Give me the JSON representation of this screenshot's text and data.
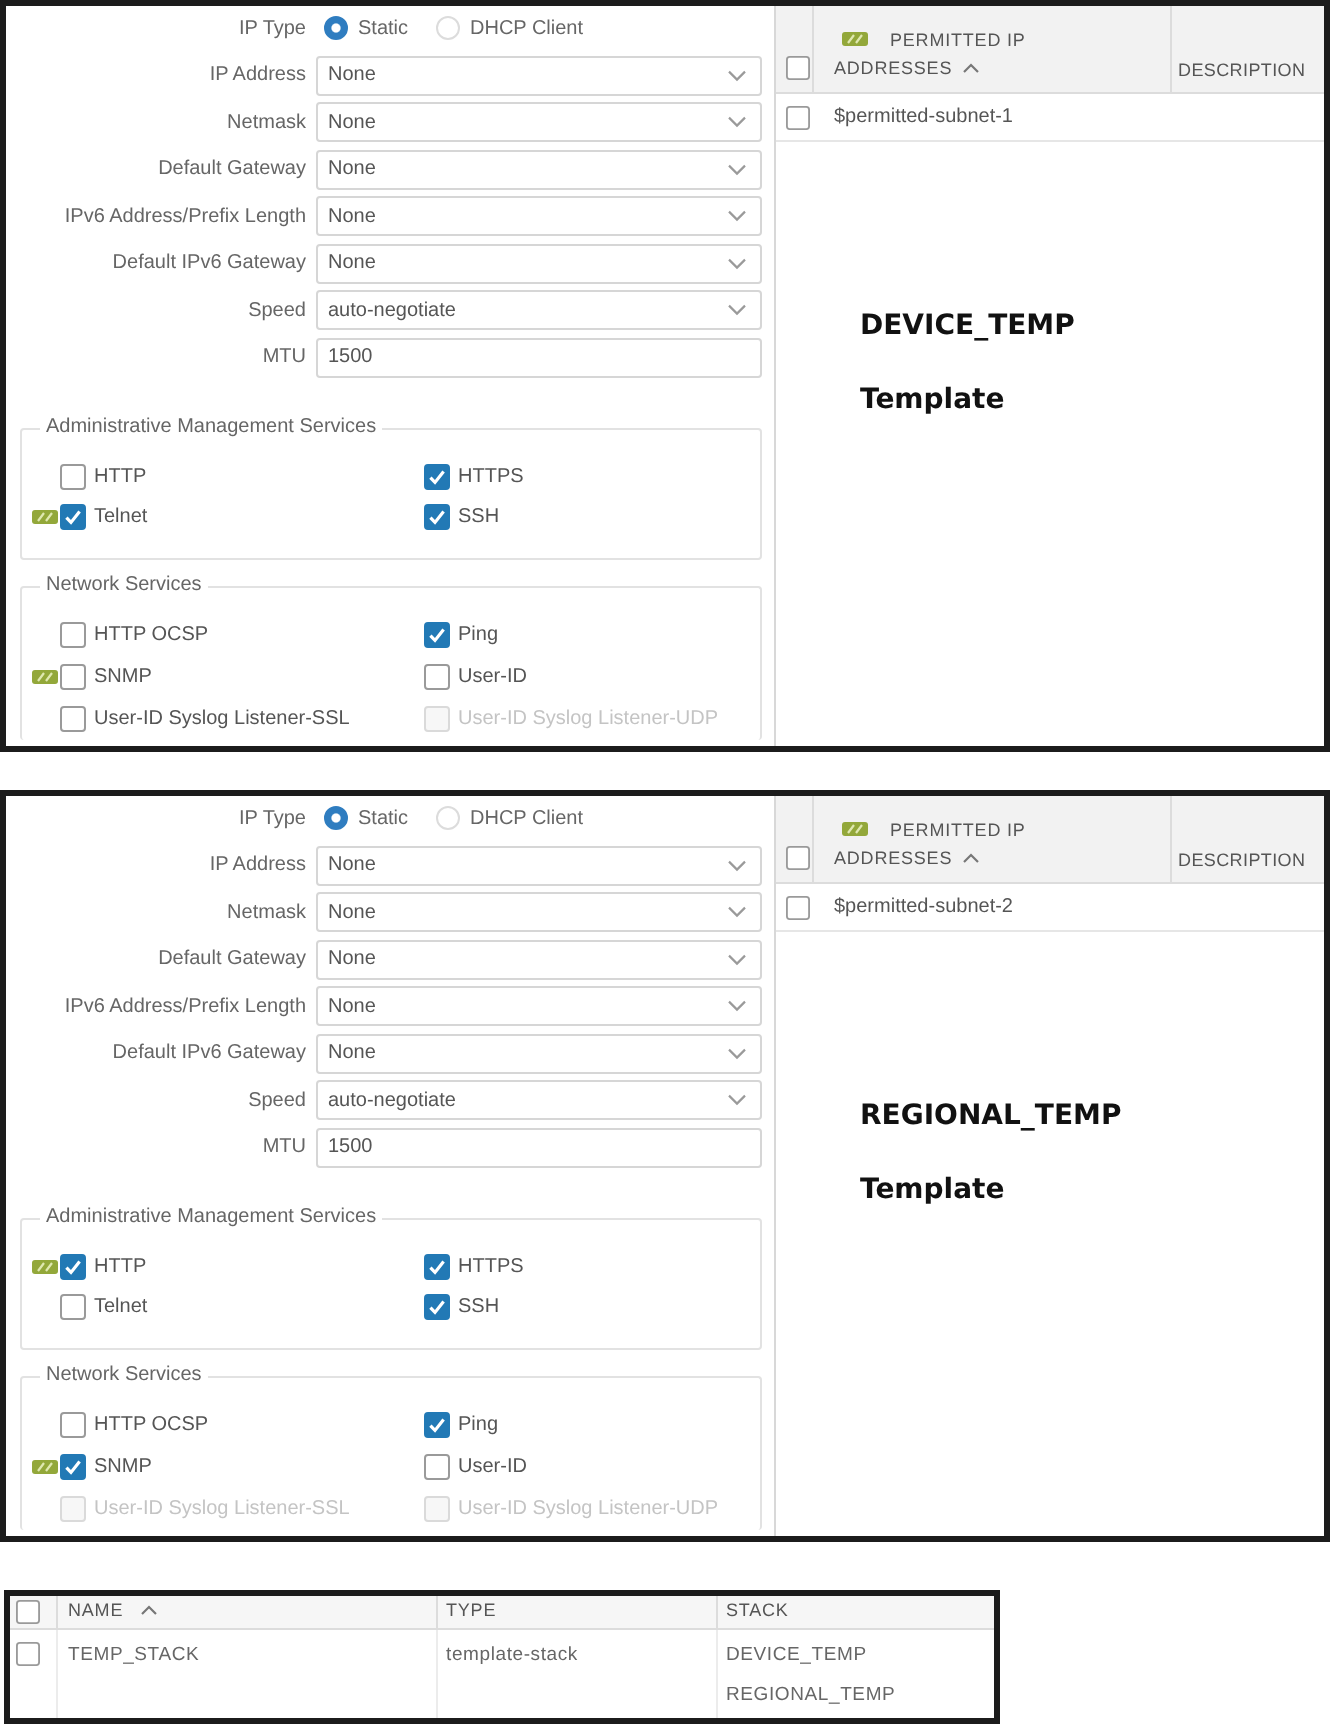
{
  "panels": [
    {
      "ip_type": {
        "label": "IP Type",
        "options": [
          {
            "label": "Static",
            "selected": true
          },
          {
            "label": "DHCP Client",
            "selected": false
          }
        ]
      },
      "fields": [
        {
          "label": "IP Address",
          "value": "None",
          "kind": "dropdown"
        },
        {
          "label": "Netmask",
          "value": "None",
          "kind": "dropdown"
        },
        {
          "label": "Default Gateway",
          "value": "None",
          "kind": "dropdown"
        },
        {
          "label": "IPv6 Address/Prefix Length",
          "value": "None",
          "kind": "dropdown"
        },
        {
          "label": "Default IPv6 Gateway",
          "value": "None",
          "kind": "dropdown"
        },
        {
          "label": "Speed",
          "value": "auto-negotiate",
          "kind": "dropdown"
        },
        {
          "label": "MTU",
          "value": "1500",
          "kind": "text"
        }
      ],
      "sections": [
        {
          "title": "Administrative Management Services",
          "items": [
            {
              "label": "HTTP",
              "checked": false,
              "template_tag": false,
              "disabled": false
            },
            {
              "label": "HTTPS",
              "checked": true,
              "template_tag": false,
              "disabled": false
            },
            {
              "label": "Telnet",
              "checked": true,
              "template_tag": true,
              "disabled": false
            },
            {
              "label": "SSH",
              "checked": true,
              "template_tag": false,
              "disabled": false
            }
          ]
        },
        {
          "title": "Network Services",
          "items": [
            {
              "label": "HTTP OCSP",
              "checked": false,
              "template_tag": false,
              "disabled": false
            },
            {
              "label": "Ping",
              "checked": true,
              "template_tag": false,
              "disabled": false
            },
            {
              "label": "SNMP",
              "checked": false,
              "template_tag": true,
              "disabled": false
            },
            {
              "label": "User-ID",
              "checked": false,
              "template_tag": false,
              "disabled": false
            },
            {
              "label": "User-ID Syslog Listener-SSL",
              "checked": false,
              "template_tag": false,
              "disabled": false
            },
            {
              "label": "User-ID Syslog Listener-UDP",
              "checked": false,
              "template_tag": false,
              "disabled": true
            }
          ]
        }
      ],
      "table": {
        "all_selected": false,
        "columns": [
          {
            "label": "PERMITTED IP ADDRESSES",
            "template_tag": true,
            "sorted_ascending": true
          },
          {
            "label": "DESCRIPTION",
            "template_tag": false,
            "sorted_ascending": false
          }
        ],
        "rows": [
          {
            "selected": false,
            "permitted_ip": "$permitted-subnet-1"
          }
        ]
      },
      "annotation": {
        "name": "DEVICE_TEMP",
        "type": "Template"
      }
    },
    {
      "ip_type": {
        "label": "IP Type",
        "options": [
          {
            "label": "Static",
            "selected": true
          },
          {
            "label": "DHCP Client",
            "selected": false
          }
        ]
      },
      "fields": [
        {
          "label": "IP Address",
          "value": "None",
          "kind": "dropdown"
        },
        {
          "label": "Netmask",
          "value": "None",
          "kind": "dropdown"
        },
        {
          "label": "Default Gateway",
          "value": "None",
          "kind": "dropdown"
        },
        {
          "label": "IPv6 Address/Prefix Length",
          "value": "None",
          "kind": "dropdown"
        },
        {
          "label": "Default IPv6 Gateway",
          "value": "None",
          "kind": "dropdown"
        },
        {
          "label": "Speed",
          "value": "auto-negotiate",
          "kind": "dropdown"
        },
        {
          "label": "MTU",
          "value": "1500",
          "kind": "text"
        }
      ],
      "sections": [
        {
          "title": "Administrative Management Services",
          "items": [
            {
              "label": "HTTP",
              "checked": true,
              "template_tag": true,
              "disabled": false
            },
            {
              "label": "HTTPS",
              "checked": true,
              "template_tag": false,
              "disabled": false
            },
            {
              "label": "Telnet",
              "checked": false,
              "template_tag": false,
              "disabled": false
            },
            {
              "label": "SSH",
              "checked": true,
              "template_tag": false,
              "disabled": false
            }
          ]
        },
        {
          "title": "Network Services",
          "items": [
            {
              "label": "HTTP OCSP",
              "checked": false,
              "template_tag": false,
              "disabled": false
            },
            {
              "label": "Ping",
              "checked": true,
              "template_tag": false,
              "disabled": false
            },
            {
              "label": "SNMP",
              "checked": true,
              "template_tag": true,
              "disabled": false
            },
            {
              "label": "User-ID",
              "checked": false,
              "template_tag": false,
              "disabled": false
            },
            {
              "label": "User-ID Syslog Listener-SSL",
              "checked": false,
              "template_tag": false,
              "disabled": true
            },
            {
              "label": "User-ID Syslog Listener-UDP",
              "checked": false,
              "template_tag": false,
              "disabled": true
            }
          ]
        }
      ],
      "table": {
        "all_selected": false,
        "columns": [
          {
            "label": "PERMITTED IP ADDRESSES",
            "template_tag": true,
            "sorted_ascending": true
          },
          {
            "label": "DESCRIPTION",
            "template_tag": false,
            "sorted_ascending": false
          }
        ],
        "rows": [
          {
            "selected": false,
            "permitted_ip": "$permitted-subnet-2"
          }
        ]
      },
      "annotation": {
        "name": "REGIONAL_TEMP",
        "type": "Template"
      }
    }
  ],
  "stack_table": {
    "all_selected": false,
    "columns": [
      {
        "label": "NAME",
        "sorted_ascending": true
      },
      {
        "label": "TYPE",
        "sorted_ascending": false
      },
      {
        "label": "STACK",
        "sorted_ascending": false
      }
    ],
    "rows": [
      {
        "selected": false,
        "name": "TEMP_STACK",
        "type": "template-stack",
        "stack": [
          "DEVICE_TEMP",
          "REGIONAL_TEMP"
        ]
      }
    ]
  }
}
